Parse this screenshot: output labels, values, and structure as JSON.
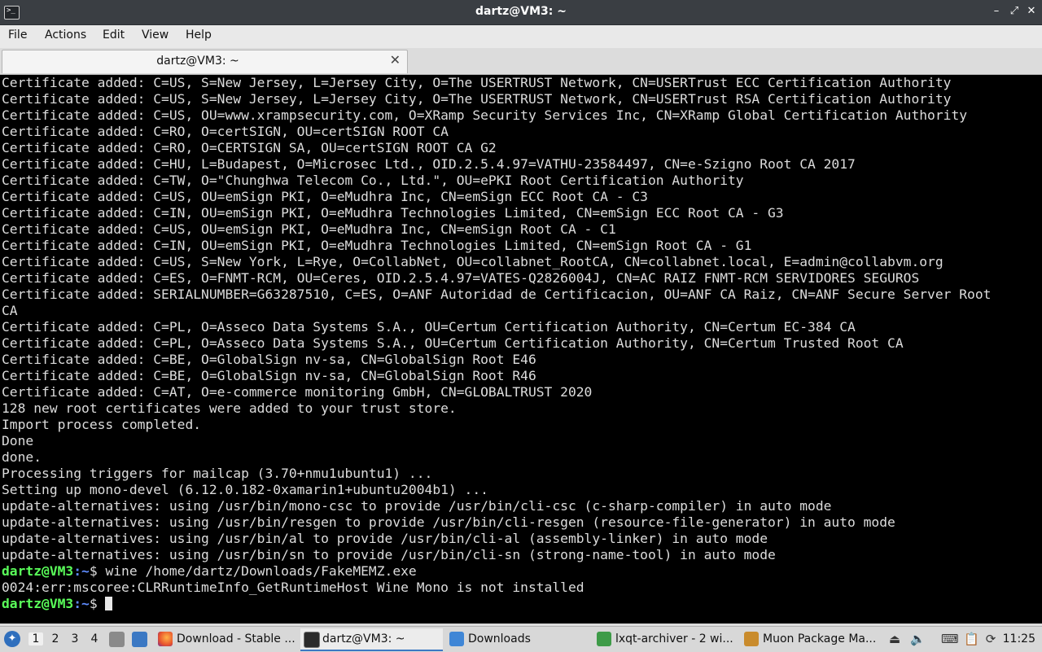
{
  "window": {
    "title": "dartz@VM3: ~",
    "icon": "terminal-icon",
    "buttons": {
      "minimize": "–",
      "restore": "⤢",
      "close": "✕"
    }
  },
  "menu": [
    "File",
    "Actions",
    "Edit",
    "View",
    "Help"
  ],
  "tab": {
    "label": "dartz@VM3: ~",
    "close": "✕"
  },
  "terminal": {
    "output": [
      "Certificate added: C=US, S=New Jersey, L=Jersey City, O=The USERTRUST Network, CN=USERTrust ECC Certification Authority",
      "Certificate added: C=US, S=New Jersey, L=Jersey City, O=The USERTRUST Network, CN=USERTrust RSA Certification Authority",
      "Certificate added: C=US, OU=www.xrampsecurity.com, O=XRamp Security Services Inc, CN=XRamp Global Certification Authority",
      "Certificate added: C=RO, O=certSIGN, OU=certSIGN ROOT CA",
      "Certificate added: C=RO, O=CERTSIGN SA, OU=certSIGN ROOT CA G2",
      "Certificate added: C=HU, L=Budapest, O=Microsec Ltd., OID.2.5.4.97=VATHU-23584497, CN=e-Szigno Root CA 2017",
      "Certificate added: C=TW, O=\"Chunghwa Telecom Co., Ltd.\", OU=ePKI Root Certification Authority",
      "Certificate added: C=US, OU=emSign PKI, O=eMudhra Inc, CN=emSign ECC Root CA - C3",
      "Certificate added: C=IN, OU=emSign PKI, O=eMudhra Technologies Limited, CN=emSign ECC Root CA - G3",
      "Certificate added: C=US, OU=emSign PKI, O=eMudhra Inc, CN=emSign Root CA - C1",
      "Certificate added: C=IN, OU=emSign PKI, O=eMudhra Technologies Limited, CN=emSign Root CA - G1",
      "Certificate added: C=US, S=New York, L=Rye, O=CollabNet, OU=collabnet_RootCA, CN=collabnet.local, E=admin@collabvm.org",
      "Certificate added: C=ES, O=FNMT-RCM, OU=Ceres, OID.2.5.4.97=VATES-Q2826004J, CN=AC RAIZ FNMT-RCM SERVIDORES SEGUROS",
      "Certificate added: SERIALNUMBER=G63287510, C=ES, O=ANF Autoridad de Certificacion, OU=ANF CA Raiz, CN=ANF Secure Server Root",
      "CA",
      "Certificate added: C=PL, O=Asseco Data Systems S.A., OU=Certum Certification Authority, CN=Certum EC-384 CA",
      "Certificate added: C=PL, O=Asseco Data Systems S.A., OU=Certum Certification Authority, CN=Certum Trusted Root CA",
      "Certificate added: C=BE, O=GlobalSign nv-sa, CN=GlobalSign Root E46",
      "Certificate added: C=BE, O=GlobalSign nv-sa, CN=GlobalSign Root R46",
      "Certificate added: C=AT, O=e-commerce monitoring GmbH, CN=GLOBALTRUST 2020",
      "128 new root certificates were added to your trust store.",
      "Import process completed.",
      "Done",
      "done.",
      "Processing triggers for mailcap (3.70+nmu1ubuntu1) ...",
      "Setting up mono-devel (6.12.0.182-0xamarin1+ubuntu2004b1) ...",
      "update-alternatives: using /usr/bin/mono-csc to provide /usr/bin/cli-csc (c-sharp-compiler) in auto mode",
      "update-alternatives: using /usr/bin/resgen to provide /usr/bin/cli-resgen (resource-file-generator) in auto mode",
      "update-alternatives: using /usr/bin/al to provide /usr/bin/cli-al (assembly-linker) in auto mode",
      "update-alternatives: using /usr/bin/sn to provide /usr/bin/cli-sn (strong-name-tool) in auto mode"
    ],
    "prompt_user": "dartz@VM3",
    "prompt_path": ":~",
    "prompt_symbol": "$ ",
    "command": "wine /home/dartz/Downloads/FakeMEMZ.exe",
    "error_line": "0024:err:mscoree:CLRRuntimeInfo_GetRuntimeHost Wine Mono is not installed",
    "colors": {
      "background": "#000000",
      "text": "#dcdcdc",
      "user": "#5aff5a",
      "path": "#5f8cff"
    }
  },
  "taskbar": {
    "menu_icon": "lxqt-menu-icon",
    "desktops": [
      "1",
      "2",
      "3",
      "4"
    ],
    "quicklaunch": [
      "file-manager-icon",
      "show-desktop-icon"
    ],
    "tasks": [
      {
        "label": "Download - Stable ...",
        "icon": "firefox-icon"
      },
      {
        "label": "dartz@VM3: ~",
        "icon": "terminal-icon"
      },
      {
        "label": "Downloads",
        "icon": "folder-icon"
      },
      {
        "label": "lxqt-archiver - 2 wi...",
        "icon": "archiver-icon"
      },
      {
        "label": "Muon Package Ma...",
        "icon": "muon-icon"
      }
    ],
    "tray": [
      "eject-icon",
      "volume-icon",
      "keyboard-icon",
      "clipboard-icon",
      "update-icon"
    ],
    "clock": "11:25"
  }
}
